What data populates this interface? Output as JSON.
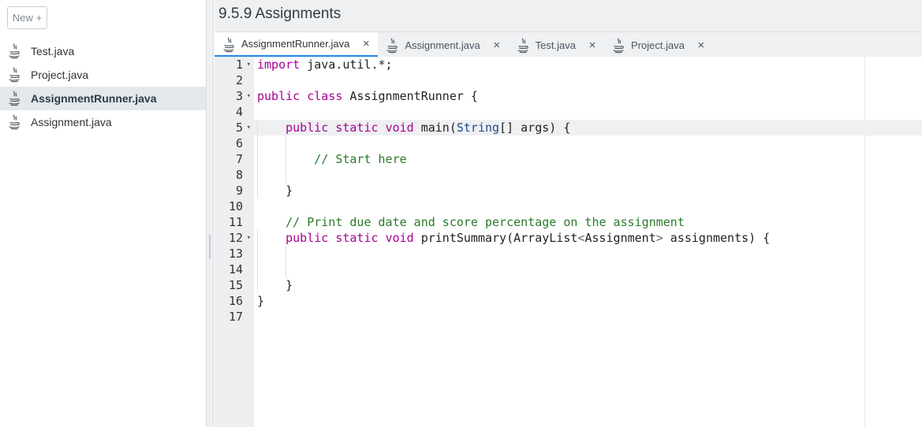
{
  "sidebar": {
    "new_button": "New +",
    "files": [
      {
        "label": "Test.java",
        "icon": "java-icon"
      },
      {
        "label": "Project.java",
        "icon": "java-icon"
      },
      {
        "label": "AssignmentRunner.java",
        "icon": "java-icon",
        "active": true
      },
      {
        "label": "Assignment.java",
        "icon": "java-icon"
      }
    ]
  },
  "main": {
    "title": "9.5.9 Assignments",
    "tabs": [
      {
        "label": "AssignmentRunner.java",
        "close": "×",
        "active": true
      },
      {
        "label": "Assignment.java",
        "close": "×"
      },
      {
        "label": "Test.java",
        "close": "×"
      },
      {
        "label": "Project.java",
        "close": "×"
      }
    ]
  },
  "editor": {
    "line_numbers": [
      "1",
      "2",
      "3",
      "4",
      "5",
      "6",
      "7",
      "8",
      "9",
      "10",
      "11",
      "12",
      "13",
      "14",
      "15",
      "16",
      "17"
    ],
    "fold_lines": [
      1,
      3,
      5,
      12
    ],
    "current_line": 5,
    "lines": [
      "import java.util.*;",
      "",
      "public class AssignmentRunner {",
      "",
      "    public static void main(String[] args) {",
      "",
      "        // Start here",
      "",
      "    }",
      "",
      "    // Print due date and score percentage on the assignment",
      "    public static void printSummary(ArrayList<Assignment> assignments) {",
      "",
      "",
      "    }",
      "}",
      ""
    ]
  },
  "colors": {
    "accent": "#1e88e5",
    "keyword": "#a80092",
    "type": "#1d4d8c",
    "comment": "#2a7a2a"
  }
}
